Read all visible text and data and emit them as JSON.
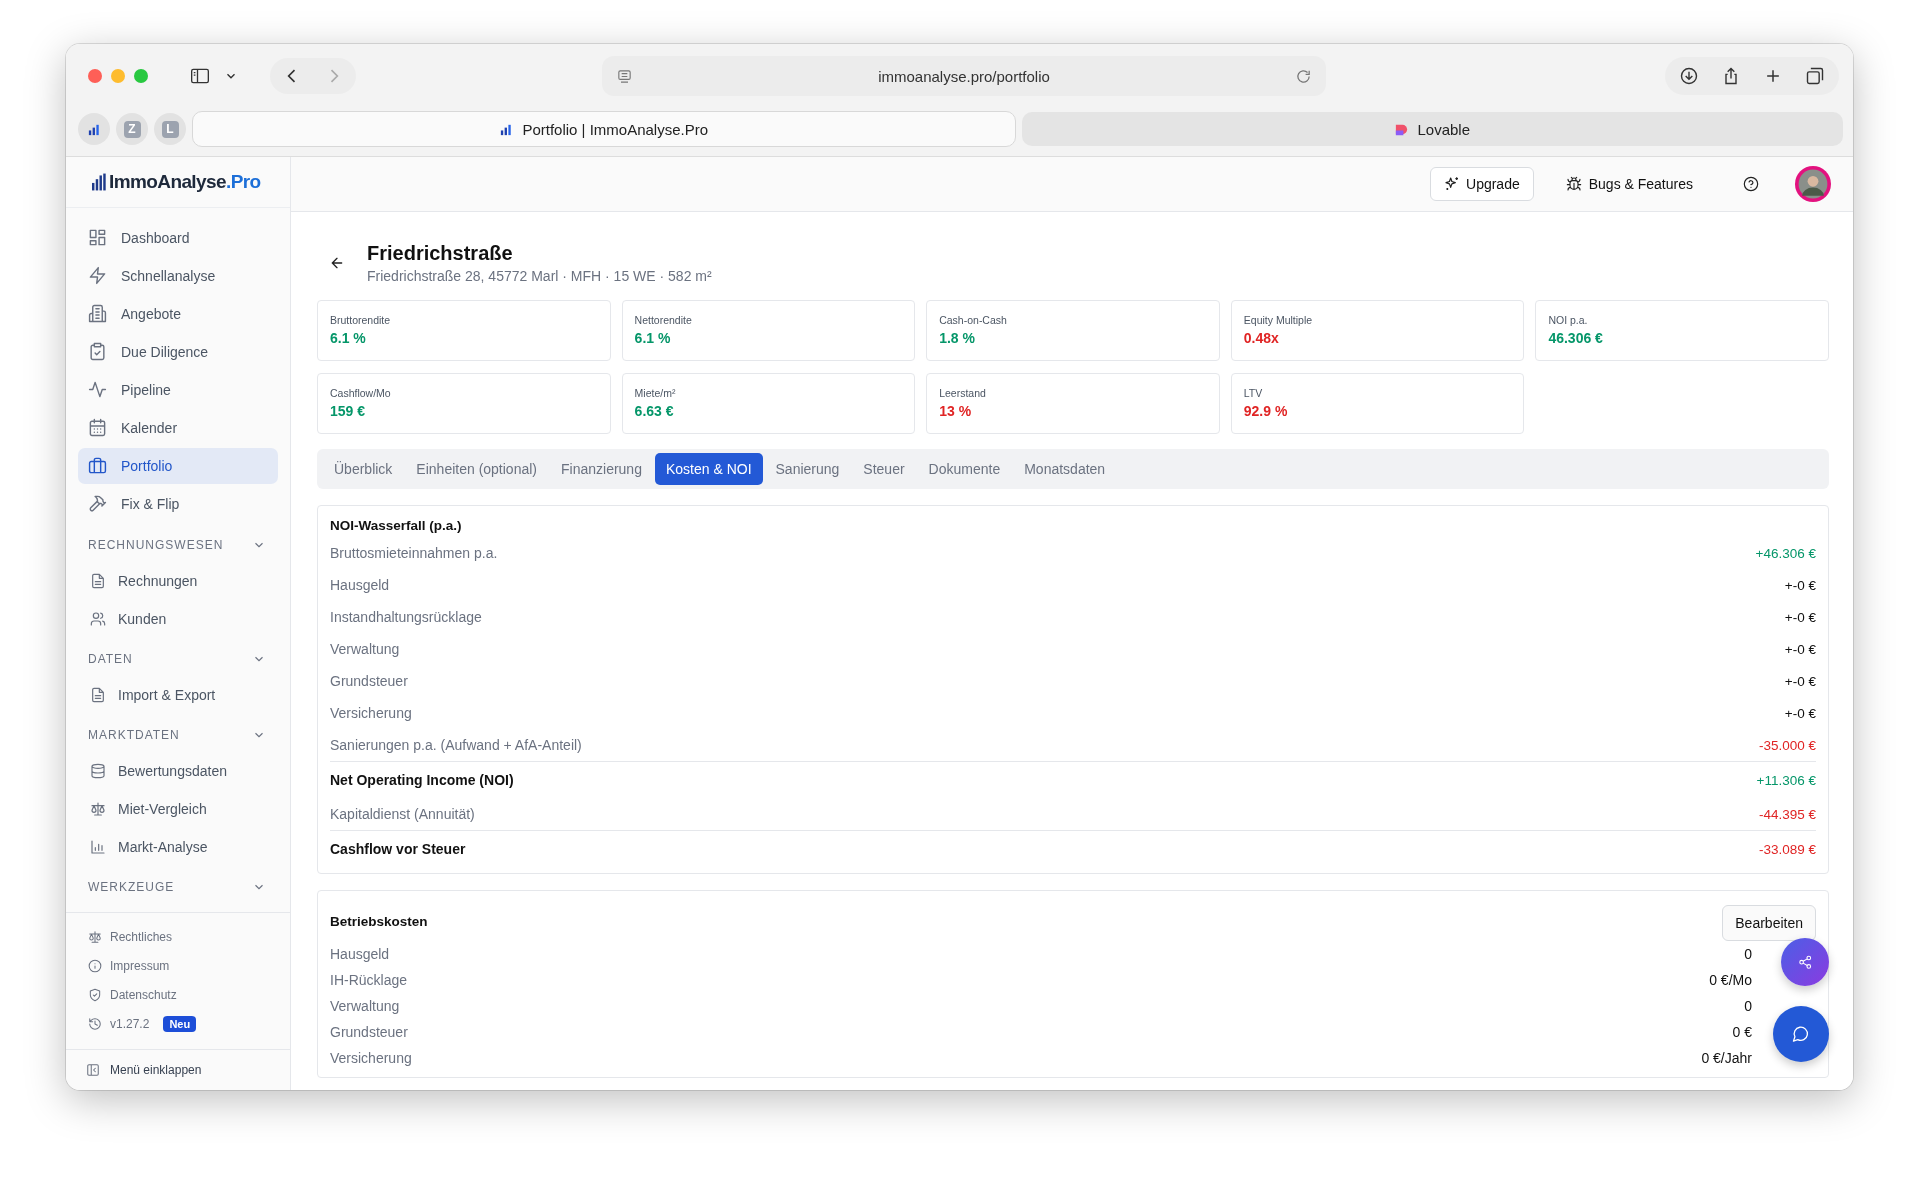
{
  "browser": {
    "url": "immoanalyse.pro/portfolio",
    "pinned_tabs": [
      {
        "label": "Z"
      },
      {
        "label": "L"
      }
    ],
    "tabs": [
      {
        "title": "Portfolio | ImmoAnalyse.Pro",
        "selected": true
      },
      {
        "title": "Lovable",
        "selected": false
      }
    ]
  },
  "sidebar": {
    "logo": {
      "main": "ImmoAnalyse",
      "suffix": ".Pro"
    },
    "nav": [
      {
        "label": "Dashboard",
        "selected": false
      },
      {
        "label": "Schnellanalyse",
        "selected": false
      },
      {
        "label": "Angebote",
        "selected": false
      },
      {
        "label": "Due Diligence",
        "selected": false
      },
      {
        "label": "Pipeline",
        "selected": false
      },
      {
        "label": "Kalender",
        "selected": false
      },
      {
        "label": "Portfolio",
        "selected": true
      },
      {
        "label": "Fix & Flip",
        "selected": false
      }
    ],
    "sections": [
      {
        "title": "RECHNUNGSWESEN",
        "expanded": true,
        "items": [
          {
            "label": "Rechnungen"
          },
          {
            "label": "Kunden"
          }
        ]
      },
      {
        "title": "DATEN",
        "expanded": true,
        "items": [
          {
            "label": "Import & Export"
          }
        ]
      },
      {
        "title": "MARKTDATEN",
        "expanded": true,
        "items": [
          {
            "label": "Bewertungsdaten"
          },
          {
            "label": "Miet-Vergleich"
          },
          {
            "label": "Markt-Analyse"
          }
        ]
      },
      {
        "title": "WERKZEUGE",
        "expanded": true
      }
    ],
    "footer_links": [
      "Rechtliches",
      "Impressum",
      "Datenschutz"
    ],
    "version": {
      "label": "v1.27.2",
      "badge": "Neu"
    },
    "collapse": "Menü einklappen"
  },
  "header": {
    "upgrade": "Upgrade",
    "bugs": "Bugs & Features"
  },
  "property": {
    "title": "Friedrichstraße",
    "subtitle": "Friedrichstraße 28, 45772 Marl · MFH · 15 WE · 582 m²"
  },
  "kpis": [
    {
      "label": "Bruttorendite",
      "value": "6.1 %",
      "color": "#059669"
    },
    {
      "label": "Nettorendite",
      "value": "6.1 %",
      "color": "#059669"
    },
    {
      "label": "Cash-on-Cash",
      "value": "1.8 %",
      "color": "#059669"
    },
    {
      "label": "Equity Multiple",
      "value": "0.48x",
      "color": "#e02424"
    },
    {
      "label": "NOI p.a.",
      "value": "46.306 €",
      "color": "#059669"
    },
    {
      "label": "Cashflow/Mo",
      "value": "159 €",
      "color": "#059669"
    },
    {
      "label": "Miete/m²",
      "value": "6.63 €",
      "color": "#059669"
    },
    {
      "label": "Leerstand",
      "value": "13 %",
      "color": "#e02424"
    },
    {
      "label": "LTV",
      "value": "92.9 %",
      "color": "#e02424"
    }
  ],
  "tabs": [
    {
      "label": "Überblick",
      "selected": false
    },
    {
      "label": "Einheiten (optional)",
      "selected": false
    },
    {
      "label": "Finanzierung",
      "selected": false
    },
    {
      "label": "Kosten & NOI",
      "selected": true
    },
    {
      "label": "Sanierung",
      "selected": false
    },
    {
      "label": "Steuer",
      "selected": false
    },
    {
      "label": "Dokumente",
      "selected": false
    },
    {
      "label": "Monatsdaten",
      "selected": false
    }
  ],
  "noi": {
    "title": "NOI-Wasserfall (p.a.)",
    "rows": [
      {
        "label": "Bruttosmieteinnahmen p.a.",
        "value": "+46.306 €",
        "kind": "line",
        "color": "#059669"
      },
      {
        "label": "Hausgeld",
        "value": "+-0 €",
        "kind": "line",
        "color": "#111111"
      },
      {
        "label": "Instandhaltungsrücklage",
        "value": "+-0 €",
        "kind": "line",
        "color": "#111111"
      },
      {
        "label": "Verwaltung",
        "value": "+-0 €",
        "kind": "line",
        "color": "#111111"
      },
      {
        "label": "Grundsteuer",
        "value": "+-0 €",
        "kind": "line",
        "color": "#111111"
      },
      {
        "label": "Versicherung",
        "value": "+-0 €",
        "kind": "line",
        "color": "#111111"
      },
      {
        "label": "Sanierungen p.a. (Aufwand + AfA-Anteil)",
        "value": "-35.000 €",
        "kind": "line",
        "color": "#e02424"
      },
      {
        "label": "Net Operating Income (NOI)",
        "value": "+11.306 €",
        "kind": "total",
        "color": "#059669"
      },
      {
        "label": "Kapitaldienst (Annuität)",
        "value": "-44.395 €",
        "kind": "line",
        "color": "#e02424"
      },
      {
        "label": "Cashflow vor Steuer",
        "value": "-33.089 €",
        "kind": "total",
        "color": "#e02424"
      }
    ]
  },
  "costs": {
    "title": "Betriebskosten",
    "edit": "Bearbeiten",
    "rows": [
      {
        "label": "Hausgeld",
        "value": "0"
      },
      {
        "label": "IH-Rücklage",
        "value": "0 €/Mo"
      },
      {
        "label": "Verwaltung",
        "value": "0"
      },
      {
        "label": "Grundsteuer",
        "value": "0 €"
      },
      {
        "label": "Versicherung",
        "value": "0 €/Jahr"
      }
    ]
  }
}
